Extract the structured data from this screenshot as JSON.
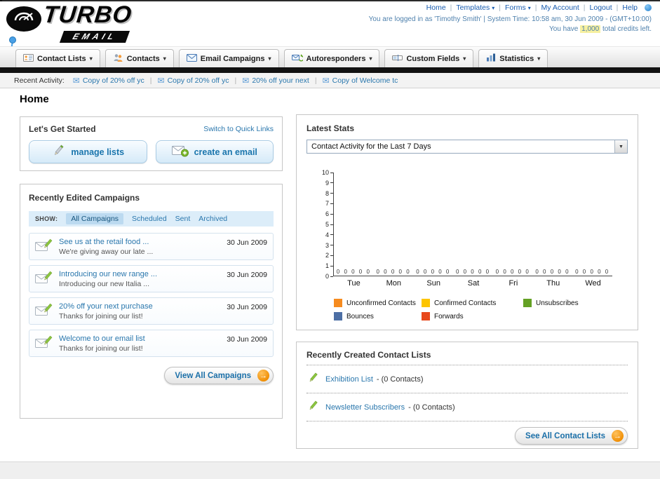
{
  "header": {
    "logo_title": "TURBO",
    "logo_subtitle": "EMAIL",
    "links": [
      {
        "label": "Home"
      },
      {
        "label": "Templates"
      },
      {
        "label": "Forms"
      },
      {
        "label": "My Account"
      },
      {
        "label": "Logout"
      },
      {
        "label": "Help"
      }
    ],
    "login_info": "You are logged in as 'Timothy Smith' | System Time: 10:58 am, 30 Jun 2009 - (GMT+10:00)",
    "credits_prefix": "You have ",
    "credits_value": "1,000",
    "credits_suffix": " total credits left."
  },
  "nav": {
    "tabs": [
      {
        "label": "Contact Lists"
      },
      {
        "label": "Contacts"
      },
      {
        "label": "Email Campaigns"
      },
      {
        "label": "Autoresponders"
      },
      {
        "label": "Custom Fields"
      },
      {
        "label": "Statistics"
      }
    ]
  },
  "recent_activity": {
    "label": "Recent Activity:",
    "items": [
      {
        "label": "Copy of 20% off yc"
      },
      {
        "label": "Copy of 20% off yc"
      },
      {
        "label": "20% off your next"
      },
      {
        "label": "Copy of Welcome tc"
      }
    ]
  },
  "page": {
    "title": "Home"
  },
  "get_started": {
    "title": "Let's Get Started",
    "switch_link": "Switch to Quick Links",
    "manage_lists_label": "manage lists",
    "create_email_label": "create an email"
  },
  "campaigns": {
    "title": "Recently Edited Campaigns",
    "show_label": "SHOW:",
    "filters": [
      {
        "label": "All Campaigns"
      },
      {
        "label": "Scheduled"
      },
      {
        "label": "Sent"
      },
      {
        "label": "Archived"
      }
    ],
    "items": [
      {
        "title": "See us at the retail food ...",
        "subtitle": "We're giving away our late ...",
        "date": "30 Jun 2009"
      },
      {
        "title": "Introducing our new range ...",
        "subtitle": "Introducing our new Italia ...",
        "date": "30 Jun 2009"
      },
      {
        "title": "20% off your next purchase",
        "subtitle": "Thanks for joining our list!",
        "date": "30 Jun 2009"
      },
      {
        "title": "Welcome to our email list",
        "subtitle": "Thanks for joining our list!",
        "date": "30 Jun 2009"
      }
    ],
    "view_all_label": "View All Campaigns"
  },
  "latest_stats": {
    "title": "Latest Stats",
    "dropdown_value": "Contact Activity for the Last 7 Days"
  },
  "contact_lists": {
    "title": "Recently Created Contact Lists",
    "items": [
      {
        "name": "Exhibition List",
        "detail": "- (0 Contacts)"
      },
      {
        "name": "Newsletter Subscribers",
        "detail": "- (0 Contacts)"
      }
    ],
    "see_all_label": "See All Contact Lists"
  },
  "icons": {
    "caret_down": "▾",
    "select_arrow": "▼",
    "arrow_right": "→",
    "envelope": "✉",
    "separator": "|"
  },
  "colors": {
    "link_blue": "#2a77ad",
    "accent_orange": "#ef8c00",
    "nav_bar_black": "#121212"
  },
  "chart_data": {
    "type": "bar",
    "title": "Contact Activity for the Last 7 Days",
    "categories": [
      "Tue",
      "Mon",
      "Sun",
      "Sat",
      "Fri",
      "Thu",
      "Wed"
    ],
    "series": [
      {
        "name": "Unconfirmed Contacts",
        "color": "#f68b1f",
        "values": [
          0,
          0,
          0,
          0,
          0,
          0,
          0
        ]
      },
      {
        "name": "Confirmed Contacts",
        "color": "#fdc500",
        "values": [
          0,
          0,
          0,
          0,
          0,
          0,
          0
        ]
      },
      {
        "name": "Unsubscribes",
        "color": "#64a124",
        "values": [
          0,
          0,
          0,
          0,
          0,
          0,
          0
        ]
      },
      {
        "name": "Bounces",
        "color": "#4d6fa5",
        "values": [
          0,
          0,
          0,
          0,
          0,
          0,
          0
        ]
      },
      {
        "name": "Forwards",
        "color": "#e8491d",
        "values": [
          0,
          0,
          0,
          0,
          0,
          0,
          0
        ]
      }
    ],
    "ylim": [
      0,
      10
    ],
    "yticks": [
      0,
      1,
      2,
      3,
      4,
      5,
      6,
      7,
      8,
      9,
      10
    ],
    "legend_position": "bottom",
    "grid": false
  }
}
